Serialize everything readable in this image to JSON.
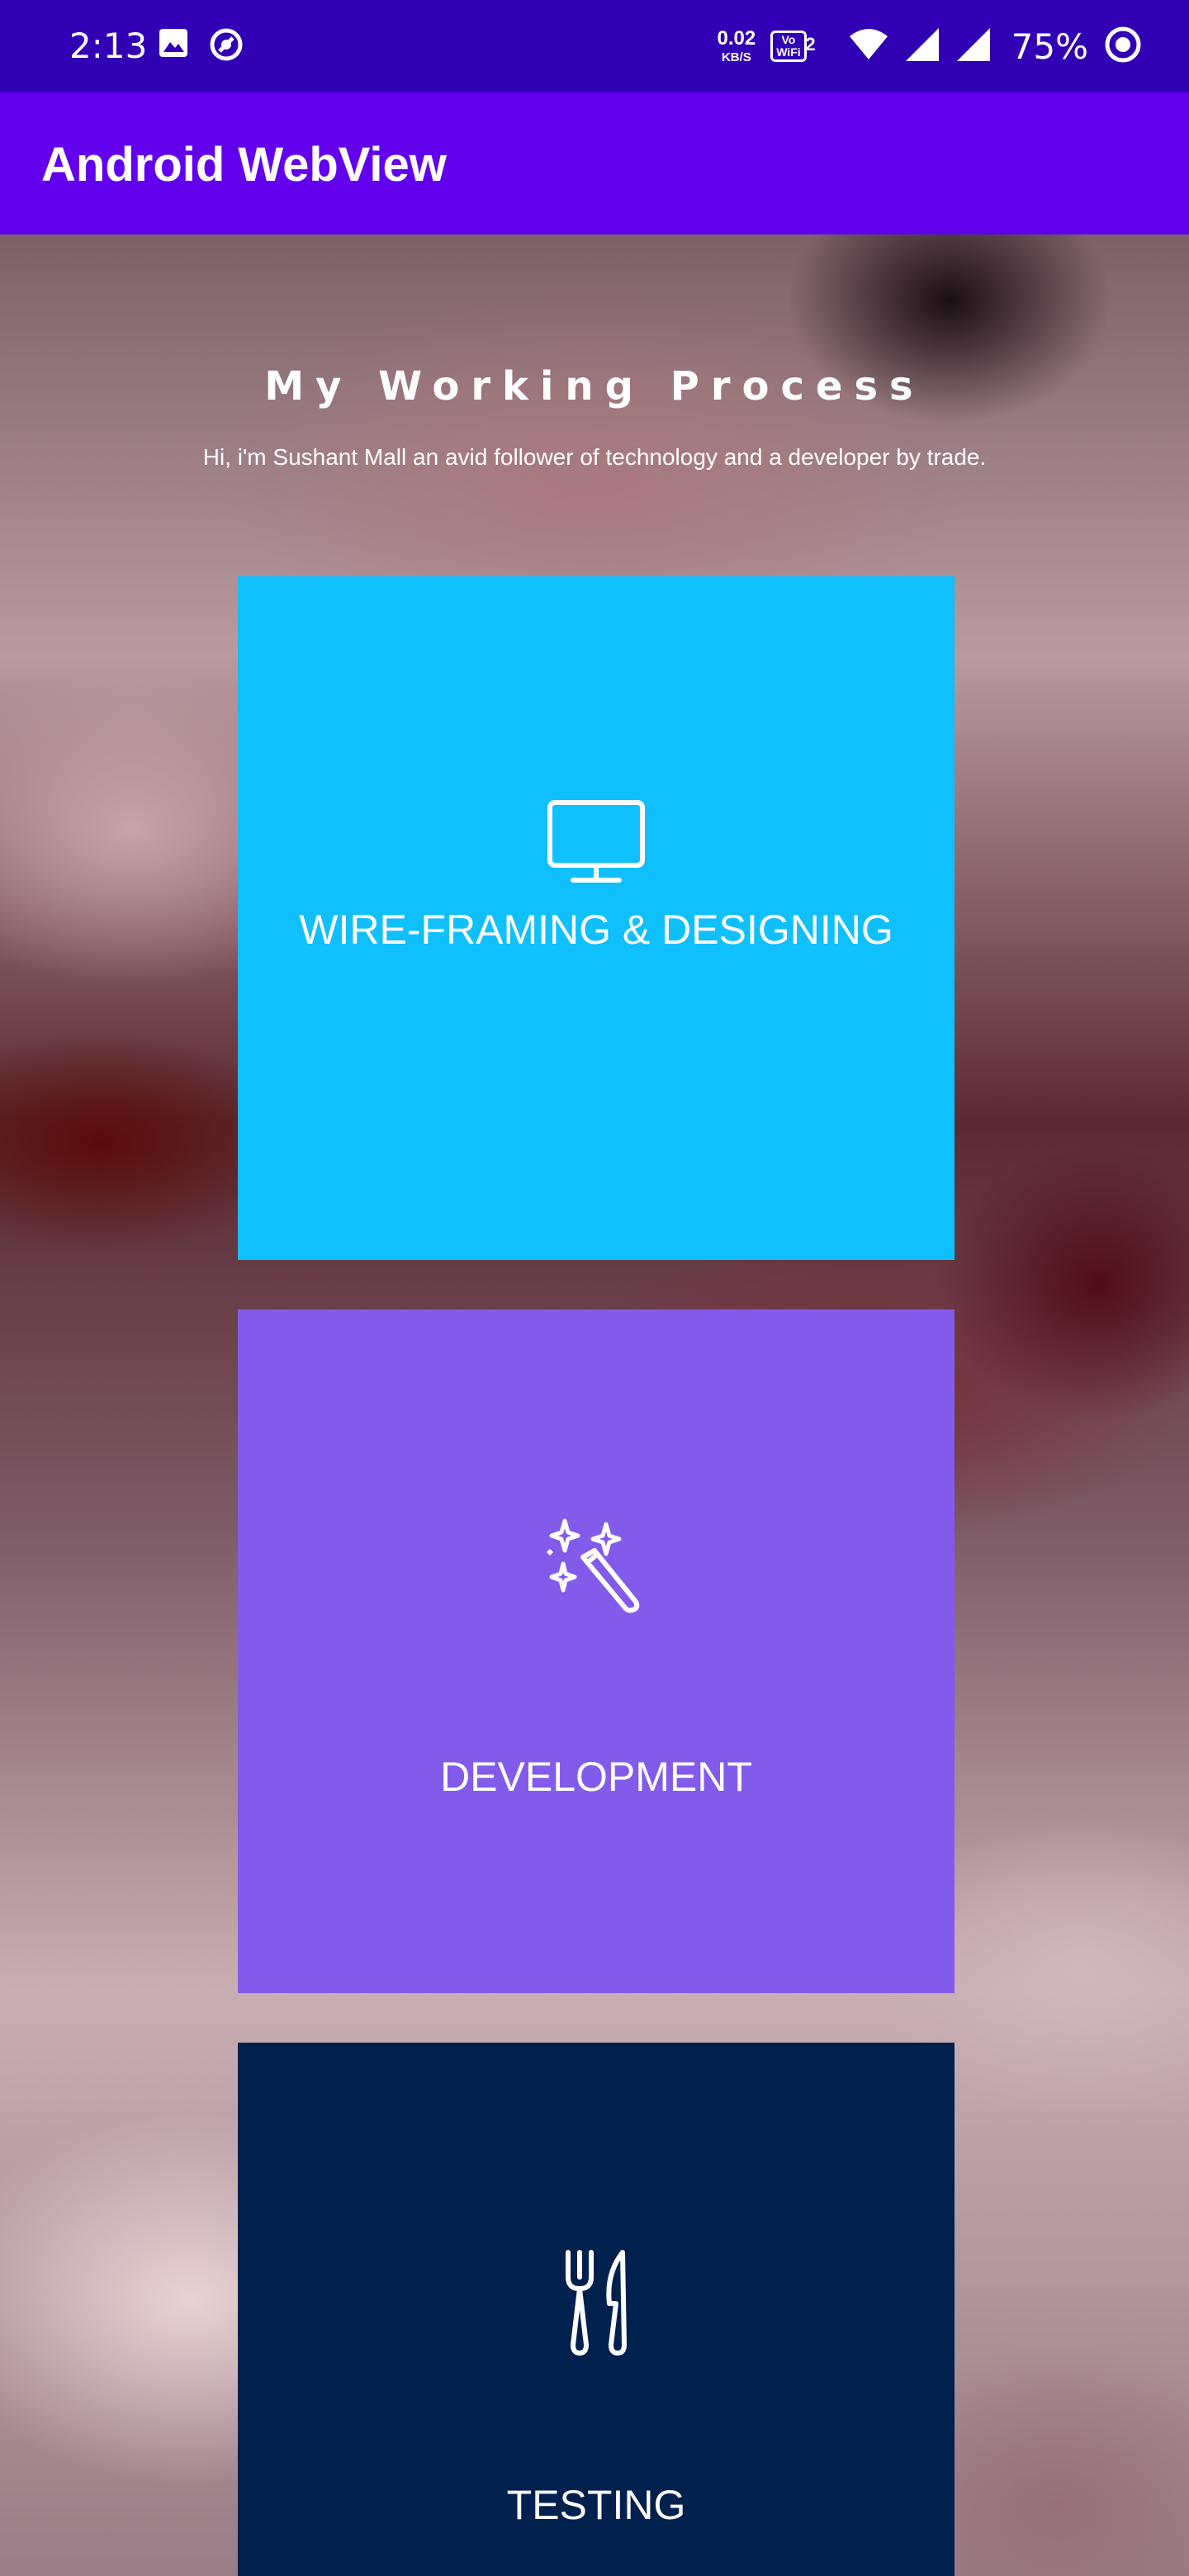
{
  "status_bar": {
    "time": "2:13",
    "net_speed_value": "0.02",
    "net_speed_unit": "KB/S",
    "vowifi_top": "Vo",
    "vowifi_bottom": "WiFi",
    "vowifi_sim": "2",
    "battery_percent": "75%",
    "icons": [
      "image-icon",
      "sync-icon",
      "wifi-icon",
      "signal-icon",
      "signal-icon",
      "battery-icon"
    ]
  },
  "app_bar": {
    "title": "Android WebView",
    "color": "#6200ee"
  },
  "page": {
    "heading": "My Working Process",
    "subtitle": "Hi, i'm Sushant Mall an avid follower of technology and a developer by trade."
  },
  "cards": [
    {
      "label": "WIRE-FRAMING & DESIGNING",
      "icon": "monitor-icon",
      "color": "#0fc0fc"
    },
    {
      "label": "DEVELOPMENT",
      "icon": "magic-wand-icon",
      "color": "#825bea"
    },
    {
      "label": "TESTING",
      "icon": "fork-knife-icon",
      "color": "#00204e"
    }
  ]
}
